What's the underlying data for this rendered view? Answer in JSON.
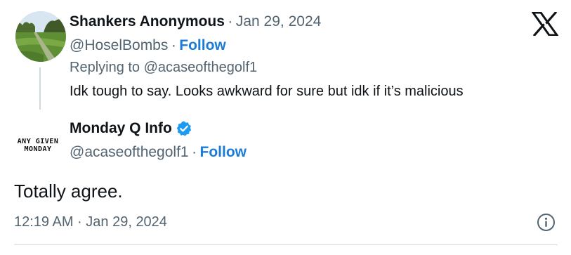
{
  "reply_tweet": {
    "author_name": "Shankers Anonymous",
    "date_separator": "·",
    "date": "Jan 29, 2024",
    "handle": "@HoselBombs",
    "dot": "·",
    "follow_label": "Follow",
    "replying_to_prefix": "Replying to",
    "replying_to_handle": "@acaseofthegolf1",
    "text": "Idk tough to say. Looks awkward for sure but idk if it’s malicious"
  },
  "main_tweet": {
    "author_name": "Monday Q Info",
    "verified": true,
    "avatar_logo_line1": "ANY GIVEN",
    "avatar_logo_line2": "MONDAY",
    "handle": "@acaseofthegolf1",
    "dot": "·",
    "follow_label": "Follow",
    "text": "Totally agree.",
    "timestamp": "12:19 AM · Jan 29, 2024"
  },
  "icons": {
    "brand": "x-logo-icon",
    "info": "info-icon",
    "verified": "verified-badge-icon"
  },
  "colors": {
    "follow": "#1d7bd8",
    "muted": "#536471",
    "verified": "#1d9bf0",
    "text": "#0f1419"
  }
}
